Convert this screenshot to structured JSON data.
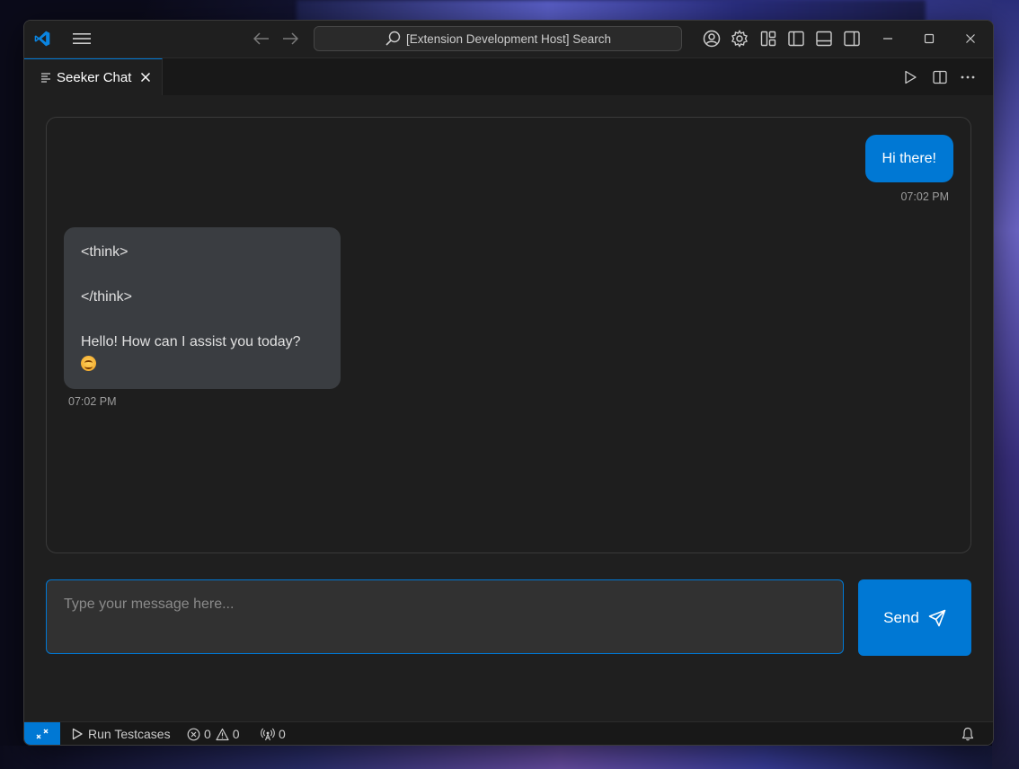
{
  "titlebar": {
    "search_label": "[Extension Development Host] Search"
  },
  "tabs": [
    {
      "label": "Seeker Chat"
    }
  ],
  "chat": {
    "messages": [
      {
        "role": "user",
        "text": "Hi there!",
        "time": "07:02 PM"
      },
      {
        "role": "assistant",
        "lines": [
          "<think>",
          "</think>",
          "Hello! How can I assist you today?"
        ],
        "time": "07:02 PM"
      }
    ]
  },
  "composer": {
    "placeholder": "Type your message here...",
    "send_label": "Send"
  },
  "statusbar": {
    "run_label": "Run Testcases",
    "errors": "0",
    "warnings": "0",
    "ports": "0"
  },
  "colors": {
    "accent": "#0078d4",
    "window_bg": "#1f1f1f",
    "bot_bubble": "#3a3d41"
  }
}
